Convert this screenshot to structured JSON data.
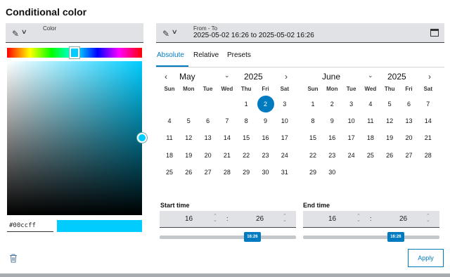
{
  "dialog": {
    "title": "Conditional color"
  },
  "color": {
    "field_label": "Color",
    "hex_value": "#00ccff",
    "selected_color": "#00ccff",
    "hue_fraction": 0.5
  },
  "date_range": {
    "field_label": "From - To",
    "value": "2025-05-02 16:26 to 2025-05-02 16:26"
  },
  "tabs": [
    "Absolute",
    "Relative",
    "Presets"
  ],
  "calendars": [
    {
      "month": "May",
      "year": "2025",
      "weekdays": [
        "Sun",
        "Mon",
        "Tue",
        "Wed",
        "Thu",
        "Fri",
        "Sat"
      ],
      "selected_day": "2",
      "weeks": [
        [
          "",
          "",
          "",
          "",
          "1",
          "2",
          "3"
        ],
        [
          "4",
          "5",
          "6",
          "7",
          "8",
          "9",
          "10"
        ],
        [
          "11",
          "12",
          "13",
          "14",
          "15",
          "16",
          "17"
        ],
        [
          "18",
          "19",
          "20",
          "21",
          "22",
          "23",
          "24"
        ],
        [
          "25",
          "26",
          "27",
          "28",
          "29",
          "30",
          "31"
        ]
      ]
    },
    {
      "month": "June",
      "year": "2025",
      "weekdays": [
        "Sun",
        "Mon",
        "Tue",
        "Wed",
        "Thu",
        "Fri",
        "Sat"
      ],
      "weeks": [
        [
          "1",
          "2",
          "3",
          "4",
          "5",
          "6",
          "7"
        ],
        [
          "8",
          "9",
          "10",
          "11",
          "12",
          "13",
          "14"
        ],
        [
          "15",
          "16",
          "17",
          "18",
          "19",
          "20",
          "21"
        ],
        [
          "22",
          "23",
          "24",
          "25",
          "26",
          "27",
          "28"
        ],
        [
          "29",
          "30",
          "",
          "",
          "",
          "",
          ""
        ]
      ]
    }
  ],
  "start_time": {
    "label": "Start time",
    "hour": "16",
    "minute": "26",
    "slider_label": "16:26",
    "slider_fraction": 0.68
  },
  "end_time": {
    "label": "End time",
    "hour": "16",
    "minute": "26",
    "slider_label": "16:26",
    "slider_fraction": 0.68
  },
  "actions": {
    "apply": "Apply"
  },
  "icons": [
    "pen-icon",
    "chevron-down-icon",
    "calendar-icon",
    "chevron-left-icon",
    "chevron-right-icon",
    "trash-icon"
  ]
}
